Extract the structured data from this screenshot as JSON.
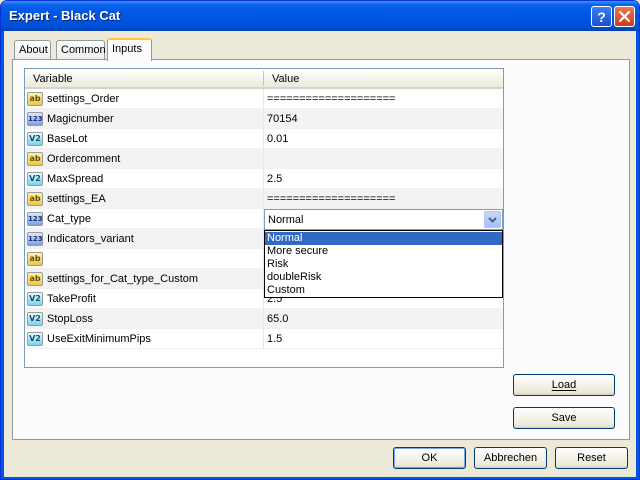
{
  "window": {
    "title": "Expert - Black Cat"
  },
  "titlebar": {
    "help_glyph": "?"
  },
  "tabs": [
    {
      "label": "About"
    },
    {
      "label": "Common"
    },
    {
      "label": "Inputs"
    }
  ],
  "grid": {
    "headers": {
      "variable": "Variable",
      "value": "Value"
    },
    "rows": [
      {
        "type": "string",
        "icon_label": "ab",
        "name": "settings_Order",
        "value": "===================="
      },
      {
        "type": "int",
        "icon_label": "123",
        "name": "Magicnumber",
        "value": "70154"
      },
      {
        "type": "double",
        "icon_label": "V2",
        "name": "BaseLot",
        "value": "0.01"
      },
      {
        "type": "string",
        "icon_label": "ab",
        "name": "Ordercomment",
        "value": ""
      },
      {
        "type": "double",
        "icon_label": "V2",
        "name": "MaxSpread",
        "value": "2.5"
      },
      {
        "type": "string",
        "icon_label": "ab",
        "name": "settings_EA",
        "value": "===================="
      },
      {
        "type": "int",
        "icon_label": "123",
        "name": "Cat_type",
        "value": "Normal"
      },
      {
        "type": "int",
        "icon_label": "123",
        "name": "Indicators_variant",
        "value": ""
      },
      {
        "type": "string",
        "icon_label": "ab",
        "name": "",
        "value": ""
      },
      {
        "type": "string",
        "icon_label": "ab",
        "name": "settings_for_Cat_type_Custom",
        "value": ""
      },
      {
        "type": "double",
        "icon_label": "V2",
        "name": "TakeProfit",
        "value": "2.5"
      },
      {
        "type": "double",
        "icon_label": "V2",
        "name": "StopLoss",
        "value": "65.0"
      },
      {
        "type": "double",
        "icon_label": "V2",
        "name": "UseExitMinimumPips",
        "value": "1.5"
      }
    ]
  },
  "combo": {
    "selected": "Normal",
    "options": [
      "Normal",
      "More secure",
      "Risk",
      "doubleRisk",
      "Custom"
    ]
  },
  "side_buttons": {
    "load": "Load",
    "save": "Save"
  },
  "footer": {
    "ok": "OK",
    "cancel": "Abbrechen",
    "reset": "Reset"
  },
  "colors": {
    "titlebar": "#0054e3",
    "selection": "#316ac5",
    "active_tab_accent": "#ffc83c"
  }
}
